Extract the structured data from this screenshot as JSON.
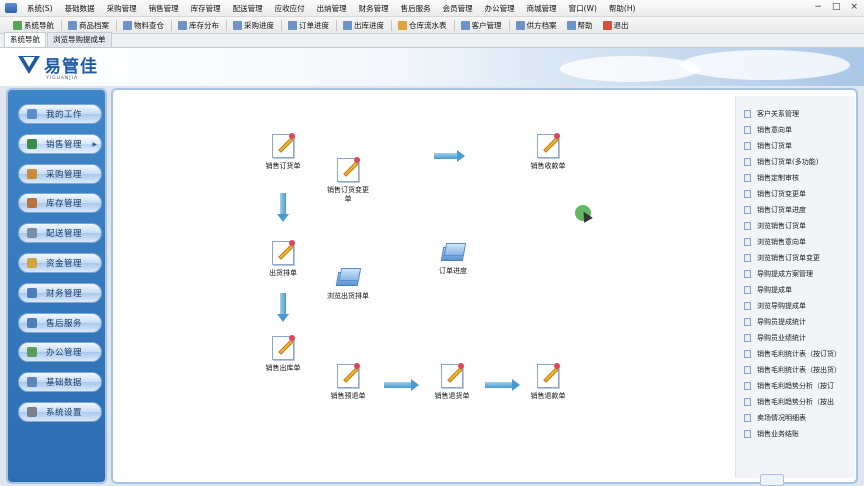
{
  "menu": [
    "系统(S)",
    "基础数据",
    "采购管理",
    "销售管理",
    "库存管理",
    "配送管理",
    "应收应付",
    "出纳管理",
    "财务管理",
    "售后服务",
    "会员管理",
    "办公管理",
    "商城管理",
    "窗口(W)",
    "帮助(H)"
  ],
  "window_controls": [
    "−",
    "□",
    "×"
  ],
  "toolbar": [
    {
      "label": "系统导航",
      "icon": "home-icon"
    },
    {
      "label": "商品档案",
      "icon": "archive-icon"
    },
    {
      "label": "物料查仓",
      "icon": "warehouse-icon"
    },
    {
      "label": "库存分布",
      "icon": "distribution-icon"
    },
    {
      "label": "采购进度",
      "icon": "purchase-icon"
    },
    {
      "label": "订单进度",
      "icon": "order-icon"
    },
    {
      "label": "出库进度",
      "icon": "outbound-icon"
    },
    {
      "label": "仓库流水表",
      "icon": "ledger-icon"
    },
    {
      "label": "客户管理",
      "icon": "customer-icon"
    },
    {
      "label": "供方档案",
      "icon": "supplier-icon"
    },
    {
      "label": "帮助",
      "icon": "help-icon"
    },
    {
      "label": "退出",
      "icon": "exit-icon"
    }
  ],
  "tabs": [
    "系统导航",
    "浏览导购提成单"
  ],
  "logo": {
    "brand": "易管佳",
    "sub": "YIGUANJIA"
  },
  "leftnav": [
    "我的工作",
    "销售管理",
    "采购管理",
    "库存管理",
    "配送管理",
    "资金管理",
    "财务管理",
    "售后服务",
    "办公管理",
    "基础数据",
    "系统设置"
  ],
  "flow": {
    "sales_order": "销售订货单",
    "order_change": "销售订货变更单",
    "receipt": "销售收款单",
    "shipping": "出货排单",
    "browse_shipping": "浏览出货排单",
    "order_progress": "订单进度",
    "outbound": "销售出库单",
    "presale_return": "销售预退单",
    "return_goods": "销售退货单",
    "refund": "销售退款单"
  },
  "rightlist": [
    "客户关系管理",
    "销售意向单",
    "销售订货单",
    "销售订货单(多功能)",
    "销售定制审核",
    "销售订货变更单",
    "销售订货单进度",
    "浏览销售订货单",
    "浏览销售意向单",
    "浏览销售订货单变更",
    "导购提成方案管理",
    "导购提成单",
    "浏览导购提成单",
    "导购员提成统计",
    "导购员业绩统计",
    "销售毛利统计表（按订货）",
    "销售毛利统计表（按出货）",
    "销售毛利趋势分析（按订",
    "销售毛利趋势分析（按出",
    "卖场情况明细表",
    "销售业务结账"
  ]
}
